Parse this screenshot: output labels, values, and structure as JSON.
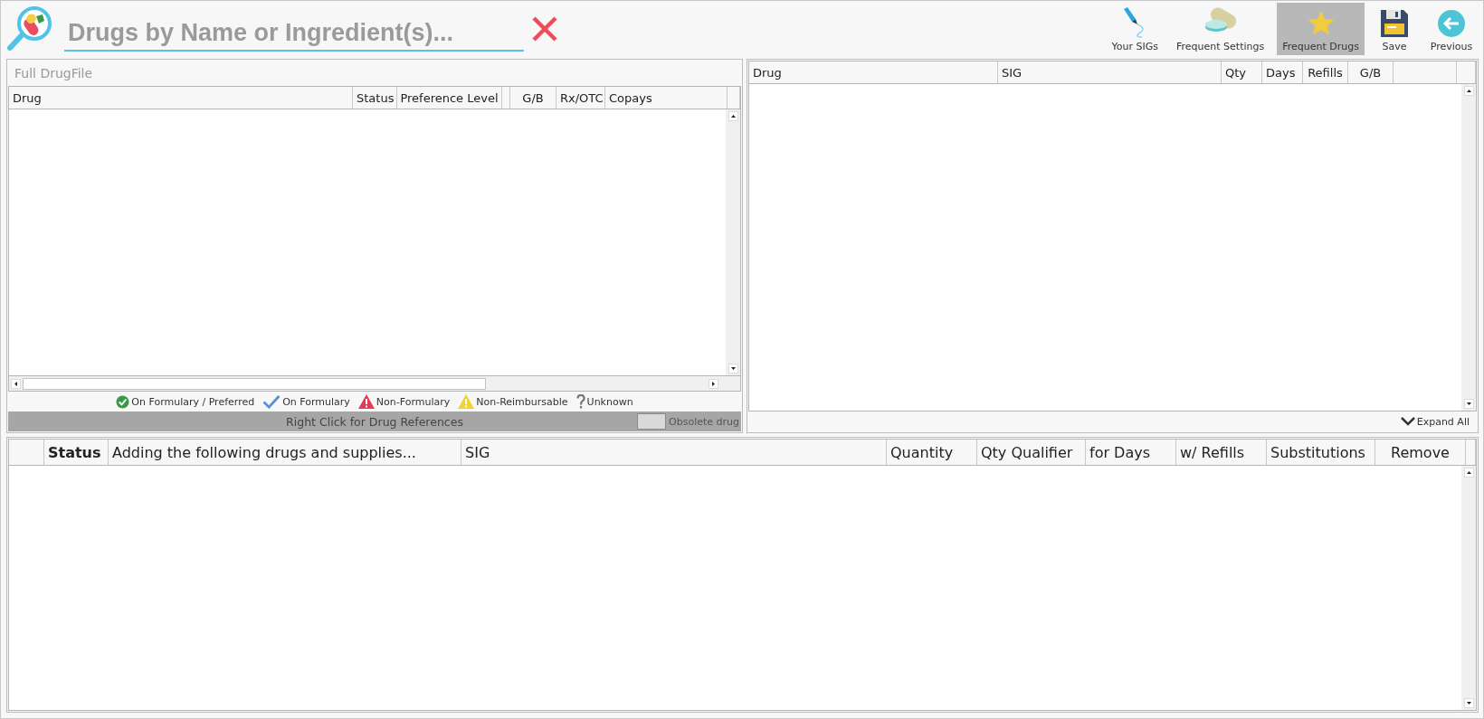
{
  "search": {
    "placeholder": "Drugs by Name or Ingredient(s)..."
  },
  "toolbar": [
    {
      "kind": "sigs",
      "label": "Your SIGs",
      "selected": false
    },
    {
      "kind": "settings",
      "label": "Frequent Settings",
      "selected": false
    },
    {
      "kind": "favorites",
      "label": "Frequent Drugs",
      "selected": true
    },
    {
      "kind": "save",
      "label": "Save",
      "selected": false
    },
    {
      "kind": "back",
      "label": "Previous",
      "selected": false
    }
  ],
  "drugfile": {
    "title": "Full DrugFile",
    "columns": [
      "Drug",
      "Status",
      "Preference Level",
      "G/B",
      "Rx/OTC",
      "Copays"
    ],
    "legend": [
      {
        "kind": "preferred",
        "label": "On Formulary / Preferred"
      },
      {
        "kind": "formulary",
        "label": "On Formulary"
      },
      {
        "kind": "non_formulary",
        "label": "Non-Formulary"
      },
      {
        "kind": "non_reimbursable",
        "label": "Non-Reimbursable"
      },
      {
        "kind": "unknown",
        "label": "Unknown"
      }
    ],
    "footer": "Right Click for Drug References",
    "obsolete_label": "Obsolete drug"
  },
  "frequent": {
    "columns": [
      "Drug",
      "SIG",
      "Qty",
      "Days",
      "Refills",
      "G/B"
    ],
    "expand": "Expand All"
  },
  "selected_drugs": {
    "columns": [
      {
        "label": "Status",
        "bold": true
      },
      {
        "label": "Adding the following drugs and supplies...",
        "bold": false
      },
      {
        "label": "SIG",
        "bold": false
      },
      {
        "label": "Quantity",
        "bold": false
      },
      {
        "label": "Qty Qualifier",
        "bold": false
      },
      {
        "label": "for Days",
        "bold": false
      },
      {
        "label": "w/ Refills",
        "bold": false
      },
      {
        "label": "Substitutions",
        "bold": false
      },
      {
        "label": "Remove",
        "bold": false
      }
    ]
  }
}
